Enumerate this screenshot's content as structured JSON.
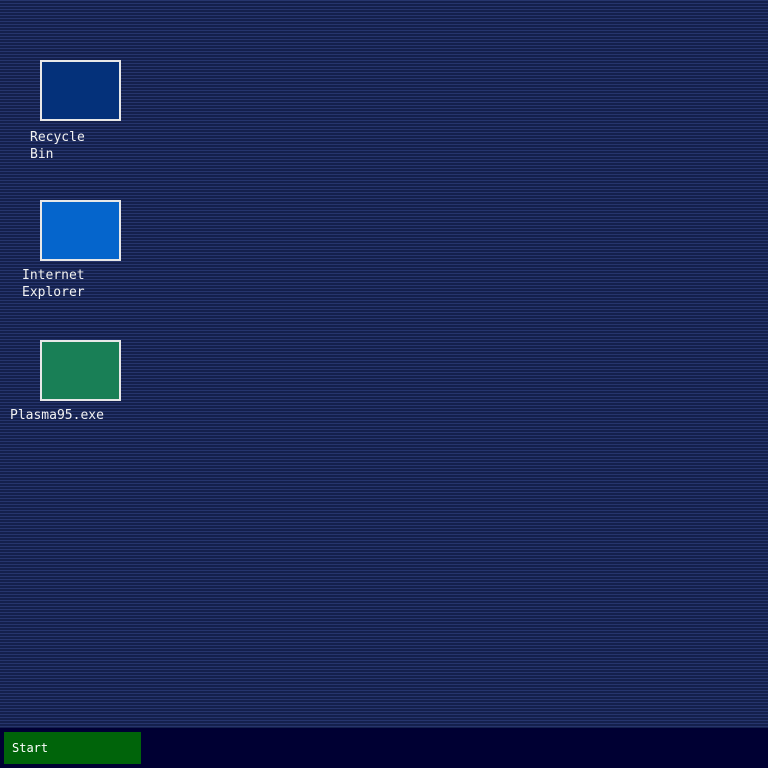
{
  "desktop": {
    "icons": [
      {
        "label": "Recycle\nBin",
        "icon": "recycle-bin-icon",
        "color": "#04317a"
      },
      {
        "label": "Internet\nExplorer",
        "icon": "internet-explorer-icon",
        "color": "#0565cc"
      },
      {
        "label": "Plasma95.exe",
        "icon": "plasma95-exe-icon",
        "color": "#197f56"
      }
    ]
  },
  "taskbar": {
    "start_label": "Start",
    "start_color": "#00640a",
    "background_color": "#000033"
  }
}
